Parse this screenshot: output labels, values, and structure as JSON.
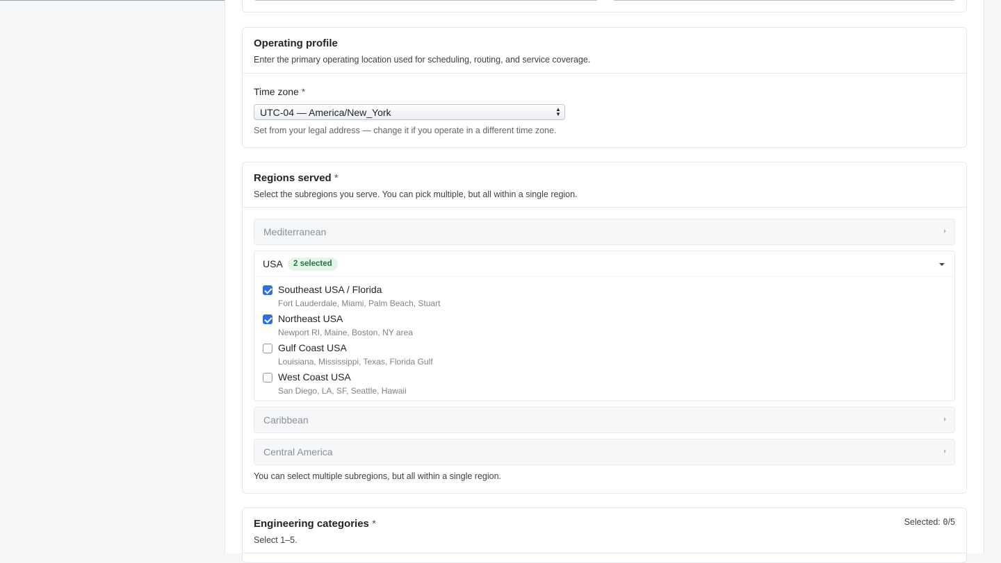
{
  "operating": {
    "title": "Operating profile",
    "description": "Enter the primary operating location used for scheduling, routing, and service coverage.",
    "timezone_label": "Time zone",
    "required_mark": "*",
    "timezone_value": "UTC-04 — America/New_York",
    "timezone_help": "Set from your legal address — change it if you operate in a different time zone."
  },
  "regions": {
    "title": "Regions served",
    "required_mark": "*",
    "description": "Select the subregions you serve. You can pick multiple, but all within a single region.",
    "collapsed": [
      {
        "label": "Mediterranean"
      },
      {
        "label": "Caribbean"
      },
      {
        "label": "Central America"
      }
    ],
    "usa": {
      "label": "USA",
      "badge": "2 selected",
      "options": [
        {
          "title": "Southeast USA / Florida",
          "sub": "Fort Lauderdale, Miami, Palm Beach, Stuart",
          "checked": true
        },
        {
          "title": "Northeast USA",
          "sub": "Newport RI, Maine, Boston, NY area",
          "checked": true
        },
        {
          "title": "Gulf Coast USA",
          "sub": "Louisiana, Mississippi, Texas, Florida Gulf",
          "checked": false
        },
        {
          "title": "West Coast USA",
          "sub": "San Diego, LA, SF, Seattle, Hawaii",
          "checked": false
        }
      ]
    },
    "help": "You can select multiple subregions, but all within a single region."
  },
  "engineering": {
    "title": "Engineering categories",
    "required_mark": "*",
    "description": "Select 1–5.",
    "selected_label": "Selected:",
    "selected_count": "0",
    "selected_max": "/5"
  }
}
